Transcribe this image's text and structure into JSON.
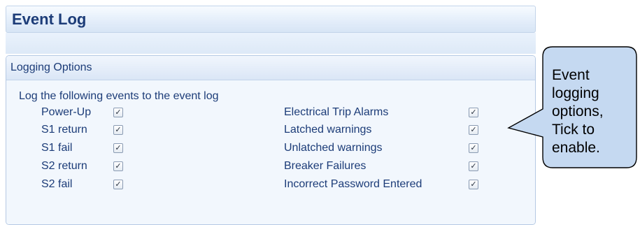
{
  "header": {
    "title": "Event Log"
  },
  "panel": {
    "title": "Logging Options",
    "intro": "Log the following events to the event log",
    "left_options": [
      {
        "label": "Power-Up",
        "checked": true
      },
      {
        "label": "S1 return",
        "checked": true
      },
      {
        "label": "S1 fail",
        "checked": true
      },
      {
        "label": "S2 return",
        "checked": true
      },
      {
        "label": "S2 fail",
        "checked": true
      }
    ],
    "right_options": [
      {
        "label": "Electrical Trip Alarms",
        "checked": true
      },
      {
        "label": "Latched warnings",
        "checked": true
      },
      {
        "label": "Unlatched warnings",
        "checked": true
      },
      {
        "label": "Breaker Failures",
        "checked": true
      },
      {
        "label": "Incorrect Password Entered",
        "checked": true
      }
    ]
  },
  "callout": {
    "lines": [
      "Event",
      "logging",
      "options,",
      "Tick to",
      "enable."
    ]
  },
  "check_glyph": "✓",
  "colors": {
    "text": "#1c3c78",
    "panel_bg": "#f2f7fd",
    "callout_fill": "#c5d9f1"
  }
}
